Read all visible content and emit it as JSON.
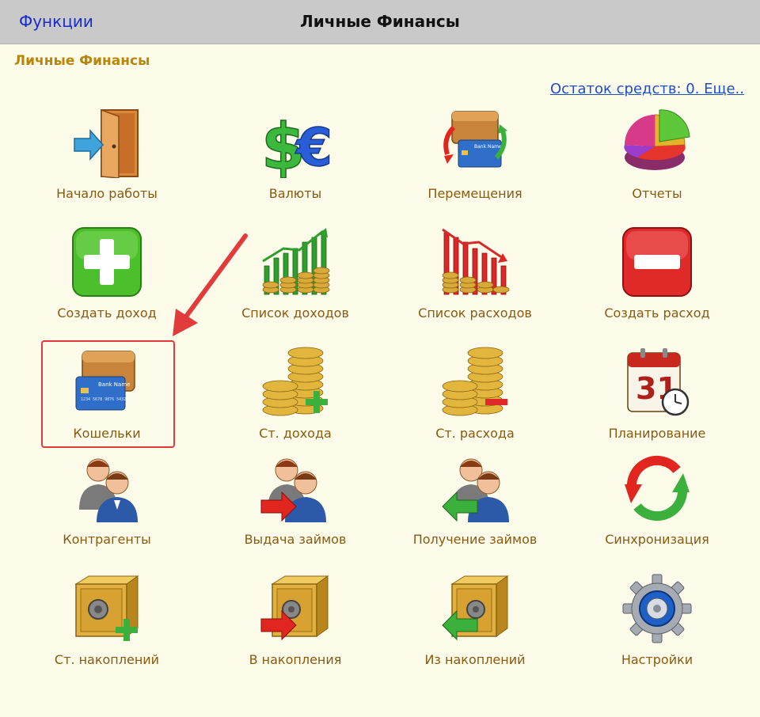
{
  "topbar": {
    "functions_label": "Функции",
    "title": "Личные Финансы"
  },
  "section_title": "Личные Финансы",
  "balance_link": "Остаток средств: 0. Еще..",
  "tiles": [
    {
      "label": "Начало работы",
      "icon": "door-arrow-icon"
    },
    {
      "label": "Валюты",
      "icon": "currency-icon"
    },
    {
      "label": "Перемещения",
      "icon": "transfer-wallet-icon"
    },
    {
      "label": "Отчеты",
      "icon": "pie-chart-icon"
    },
    {
      "label": "Создать доход",
      "icon": "plus-icon"
    },
    {
      "label": "Список доходов",
      "icon": "income-chart-icon"
    },
    {
      "label": "Список расходов",
      "icon": "expense-chart-icon"
    },
    {
      "label": "Создать расход",
      "icon": "minus-icon"
    },
    {
      "label": "Кошельки",
      "icon": "wallet-card-icon"
    },
    {
      "label": "Ст. дохода",
      "icon": "coins-plus-icon"
    },
    {
      "label": "Ст. расхода",
      "icon": "coins-minus-icon"
    },
    {
      "label": "Планирование",
      "icon": "calendar-clock-icon"
    },
    {
      "label": "Контрагенты",
      "icon": "people-icon"
    },
    {
      "label": "Выдача займов",
      "icon": "people-arrow-out-icon"
    },
    {
      "label": "Получение займов",
      "icon": "people-arrow-in-icon"
    },
    {
      "label": "Синхронизация",
      "icon": "sync-icon"
    },
    {
      "label": "Ст. накоплений",
      "icon": "safe-plus-icon"
    },
    {
      "label": "В накопления",
      "icon": "safe-arrow-in-icon"
    },
    {
      "label": "Из накоплений",
      "icon": "safe-arrow-out-icon"
    },
    {
      "label": "Настройки",
      "icon": "gear-icon"
    }
  ],
  "card_text": {
    "bank": "Bank Name",
    "number": "1234 5678 9876 5432"
  },
  "calendar_day": "31",
  "colors": {
    "accent_blue": "#1a2cc8",
    "label": "#8a5a10",
    "title_gold": "#b8860b",
    "highlight": "#e23b3b"
  }
}
